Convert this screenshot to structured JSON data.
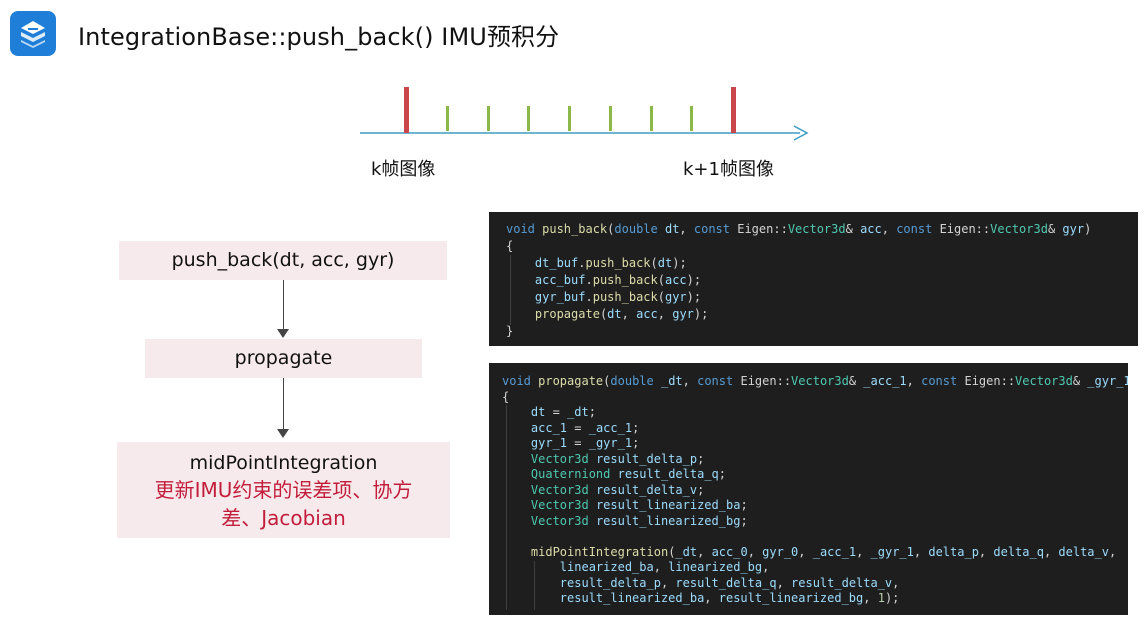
{
  "header": {
    "title": "IntegrationBase::push_back() IMU预积分",
    "logo_icon": "company-logo-icon",
    "accent_color": "#1f7ed8"
  },
  "timeline": {
    "start_label": "k帧图像",
    "end_label": "k+1帧图像",
    "frame_marker_color": "#c9474b",
    "imu_marker_color": "#8ab94a",
    "axis_color": "#3b9ec4",
    "imu_samples_between_frames": 7
  },
  "flow": {
    "step1": "push_back(dt, acc, gyr)",
    "step2": "propagate",
    "step3": "midPointIntegration",
    "step3_note_line1": "更新IMU约束的误差项、协方",
    "step3_note_line2": "差、Jacobian",
    "note_color": "#c21d3b"
  },
  "code_push_back": [
    [
      [
        "kw",
        "void "
      ],
      [
        "fn",
        "push_back"
      ],
      [
        "",
        "("
      ],
      [
        "kw",
        "double "
      ],
      [
        "vr",
        "dt"
      ],
      [
        "",
        ", "
      ],
      [
        "kw",
        "const "
      ],
      [
        "",
        "Eigen::"
      ],
      [
        "ty",
        "Vector3d"
      ],
      [
        "",
        "& "
      ],
      [
        "vr",
        "acc"
      ],
      [
        "",
        ", "
      ],
      [
        "kw",
        "const "
      ],
      [
        "",
        "Eigen::"
      ],
      [
        "ty",
        "Vector3d"
      ],
      [
        "",
        "& "
      ],
      [
        "vr",
        "gyr"
      ],
      [
        "",
        ")"
      ]
    ],
    [
      [
        "",
        "{"
      ]
    ],
    [
      [
        "",
        "    "
      ],
      [
        "vr",
        "dt_buf"
      ],
      [
        "",
        "."
      ],
      [
        "fn",
        "push_back"
      ],
      [
        "",
        "("
      ],
      [
        "vr",
        "dt"
      ],
      [
        "",
        ");"
      ]
    ],
    [
      [
        "",
        "    "
      ],
      [
        "vr",
        "acc_buf"
      ],
      [
        "",
        "."
      ],
      [
        "fn",
        "push_back"
      ],
      [
        "",
        "("
      ],
      [
        "vr",
        "acc"
      ],
      [
        "",
        ");"
      ]
    ],
    [
      [
        "",
        "    "
      ],
      [
        "vr",
        "gyr_buf"
      ],
      [
        "",
        "."
      ],
      [
        "fn",
        "push_back"
      ],
      [
        "",
        "("
      ],
      [
        "vr",
        "gyr"
      ],
      [
        "",
        ");"
      ]
    ],
    [
      [
        "",
        "    "
      ],
      [
        "fn",
        "propagate"
      ],
      [
        "",
        "("
      ],
      [
        "vr",
        "dt"
      ],
      [
        "",
        ", "
      ],
      [
        "vr",
        "acc"
      ],
      [
        "",
        ", "
      ],
      [
        "vr",
        "gyr"
      ],
      [
        "",
        ");"
      ]
    ],
    [
      [
        "",
        "}"
      ]
    ]
  ],
  "code_propagate": [
    [
      [
        "kw",
        "void "
      ],
      [
        "fn",
        "propagate"
      ],
      [
        "",
        "("
      ],
      [
        "kw",
        "double "
      ],
      [
        "vr",
        "_dt"
      ],
      [
        "",
        ", "
      ],
      [
        "kw",
        "const "
      ],
      [
        "",
        "Eigen::"
      ],
      [
        "ty",
        "Vector3d"
      ],
      [
        "",
        "& "
      ],
      [
        "vr",
        "_acc_1"
      ],
      [
        "",
        ", "
      ],
      [
        "kw",
        "const "
      ],
      [
        "",
        "Eigen::"
      ],
      [
        "ty",
        "Vector3d"
      ],
      [
        "",
        "& "
      ],
      [
        "vr",
        "_gyr_1"
      ],
      [
        "",
        ")"
      ]
    ],
    [
      [
        "",
        "{"
      ]
    ],
    [
      [
        "",
        "    "
      ],
      [
        "vr",
        "dt"
      ],
      [
        "",
        " = "
      ],
      [
        "vr",
        "_dt"
      ],
      [
        "",
        ";"
      ]
    ],
    [
      [
        "",
        "    "
      ],
      [
        "vr",
        "acc_1"
      ],
      [
        "",
        " = "
      ],
      [
        "vr",
        "_acc_1"
      ],
      [
        "",
        ";"
      ]
    ],
    [
      [
        "",
        "    "
      ],
      [
        "vr",
        "gyr_1"
      ],
      [
        "",
        " = "
      ],
      [
        "vr",
        "_gyr_1"
      ],
      [
        "",
        ";"
      ]
    ],
    [
      [
        "",
        "    "
      ],
      [
        "ty",
        "Vector3d"
      ],
      [
        "",
        " "
      ],
      [
        "vr",
        "result_delta_p"
      ],
      [
        "",
        ";"
      ]
    ],
    [
      [
        "",
        "    "
      ],
      [
        "ty",
        "Quaterniond"
      ],
      [
        "",
        " "
      ],
      [
        "vr",
        "result_delta_q"
      ],
      [
        "",
        ";"
      ]
    ],
    [
      [
        "",
        "    "
      ],
      [
        "ty",
        "Vector3d"
      ],
      [
        "",
        " "
      ],
      [
        "vr",
        "result_delta_v"
      ],
      [
        "",
        ";"
      ]
    ],
    [
      [
        "",
        "    "
      ],
      [
        "ty",
        "Vector3d"
      ],
      [
        "",
        " "
      ],
      [
        "vr",
        "result_linearized_ba"
      ],
      [
        "",
        ";"
      ]
    ],
    [
      [
        "",
        "    "
      ],
      [
        "ty",
        "Vector3d"
      ],
      [
        "",
        " "
      ],
      [
        "vr",
        "result_linearized_bg"
      ],
      [
        "",
        ";"
      ]
    ],
    [
      [
        "",
        ""
      ]
    ],
    [
      [
        "",
        "    "
      ],
      [
        "fn",
        "midPointIntegration"
      ],
      [
        "",
        "("
      ],
      [
        "vr",
        "_dt"
      ],
      [
        "",
        ", "
      ],
      [
        "vr",
        "acc_0"
      ],
      [
        "",
        ", "
      ],
      [
        "vr",
        "gyr_0"
      ],
      [
        "",
        ", "
      ],
      [
        "vr",
        "_acc_1"
      ],
      [
        "",
        ", "
      ],
      [
        "vr",
        "_gyr_1"
      ],
      [
        "",
        ", "
      ],
      [
        "vr",
        "delta_p"
      ],
      [
        "",
        ", "
      ],
      [
        "vr",
        "delta_q"
      ],
      [
        "",
        ", "
      ],
      [
        "vr",
        "delta_v"
      ],
      [
        "",
        ","
      ]
    ],
    [
      [
        "",
        "        "
      ],
      [
        "vr",
        "linearized_ba"
      ],
      [
        "",
        ", "
      ],
      [
        "vr",
        "linearized_bg"
      ],
      [
        "",
        ","
      ]
    ],
    [
      [
        "",
        "        "
      ],
      [
        "vr",
        "result_delta_p"
      ],
      [
        "",
        ", "
      ],
      [
        "vr",
        "result_delta_q"
      ],
      [
        "",
        ", "
      ],
      [
        "vr",
        "result_delta_v"
      ],
      [
        "",
        ","
      ]
    ],
    [
      [
        "",
        "        "
      ],
      [
        "vr",
        "result_linearized_ba"
      ],
      [
        "",
        ", "
      ],
      [
        "vr",
        "result_linearized_bg"
      ],
      [
        "",
        ", "
      ],
      [
        "nm",
        "1"
      ],
      [
        "",
        ");"
      ]
    ]
  ]
}
